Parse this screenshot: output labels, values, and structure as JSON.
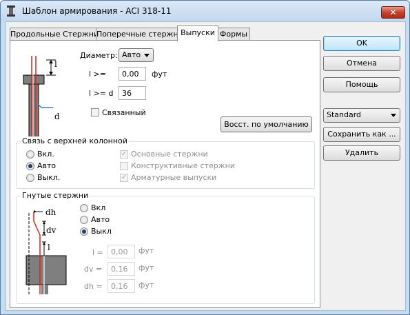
{
  "window": {
    "title": "Шаблон армирования - ACI 318-11",
    "close_label": "✕"
  },
  "tabs": [
    {
      "label": "Продольные Стержни",
      "active": false
    },
    {
      "label": "Поперечные стержни",
      "active": false
    },
    {
      "label": "Выпуски",
      "active": true
    },
    {
      "label": "Формы",
      "active": false
    }
  ],
  "dowels": {
    "diagram_labels": {
      "l": "l",
      "d": "d"
    },
    "diameter_label": "Диаметр:",
    "diameter_value": "Авто",
    "l_ge_label": "l  >=",
    "l_ge_value": "0,00",
    "l_unit": "фут",
    "l_ge_d_label": "l >= d",
    "l_ge_d_value": "36",
    "bound_label": "Связанный",
    "bound_checked": false,
    "restore_button": "Восст. по умолчанию"
  },
  "upper_column": {
    "title": "Связь с верхней колонной",
    "options": [
      {
        "label": "Вкл.",
        "selected": false
      },
      {
        "label": "Авто",
        "selected": true
      },
      {
        "label": "Выкл.",
        "selected": false
      }
    ],
    "checks": [
      {
        "label": "Основные стержни",
        "checked": true
      },
      {
        "label": "Конструктивные стержни",
        "checked": false
      },
      {
        "label": "Арматурные выпуски",
        "checked": true
      }
    ]
  },
  "bent_bars": {
    "title": "Гнутые стержни",
    "diagram_labels": {
      "dh": "dh",
      "dv": "dv",
      "l": "l"
    },
    "options": [
      {
        "label": "Вкл",
        "selected": false
      },
      {
        "label": "Авто",
        "selected": false
      },
      {
        "label": "Выкл",
        "selected": true
      }
    ],
    "fields": [
      {
        "label": "l  =",
        "value": "0,00",
        "unit": "фут"
      },
      {
        "label": "dv =",
        "value": "0,16",
        "unit": "фут"
      },
      {
        "label": "dh =",
        "value": "0,16",
        "unit": "фут"
      }
    ]
  },
  "side": {
    "ok": "OK",
    "cancel": "Отмена",
    "help": "Помощь",
    "template_value": "Standard",
    "save_as": "Сохранить как ...",
    "delete": "Удалить"
  },
  "colors": {
    "accent_red": "#d9231f",
    "accent_blue": "#2a7fd4",
    "section_fill": "#7f7f7f"
  }
}
